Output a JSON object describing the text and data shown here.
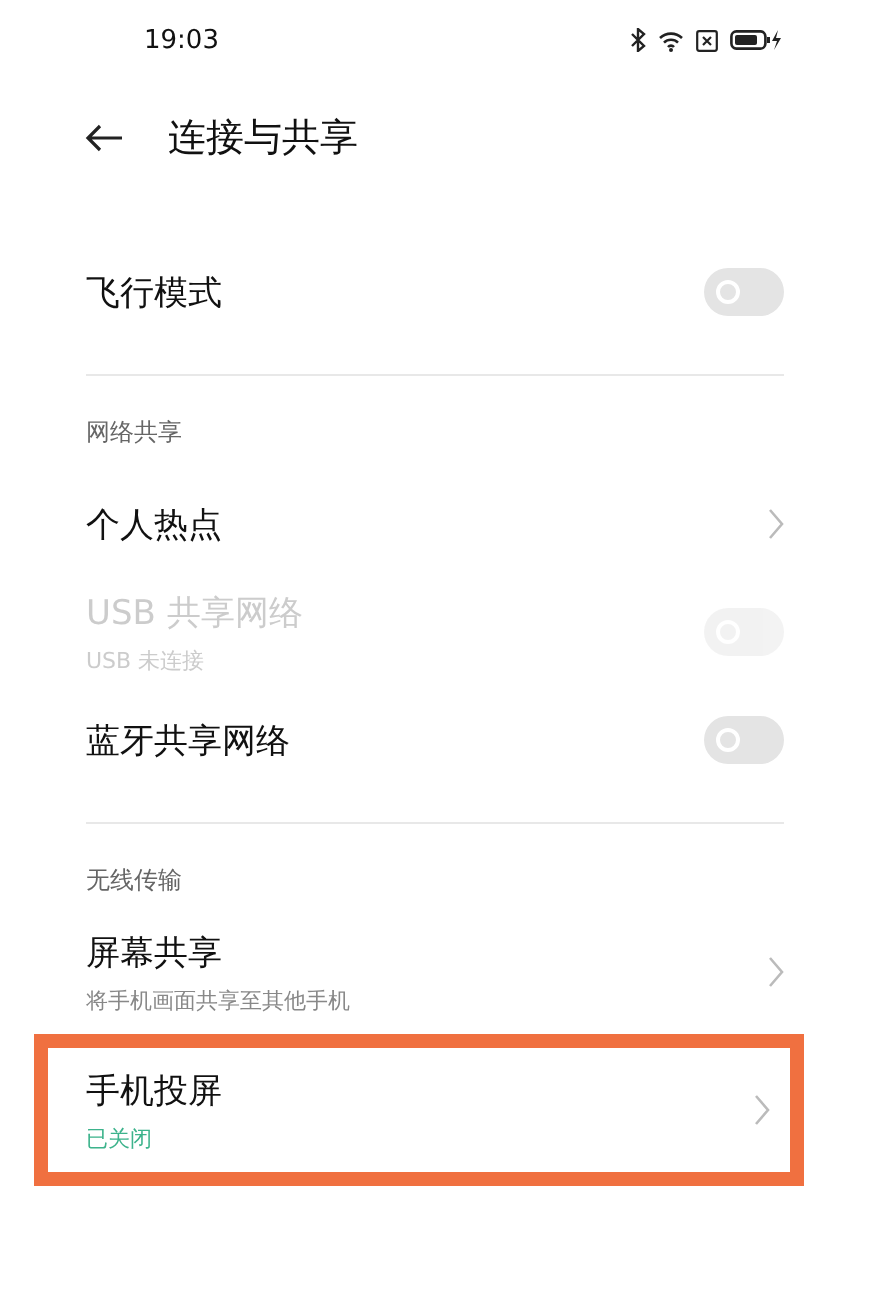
{
  "status_bar": {
    "time": "19:03"
  },
  "header": {
    "title": "连接与共享"
  },
  "sections": [
    {
      "items": [
        {
          "kind": "toggle",
          "title": "飞行模式",
          "on": false,
          "disabled": false,
          "highlighted": false
        }
      ]
    },
    {
      "heading": "网络共享",
      "items": [
        {
          "kind": "link",
          "title": "个人热点",
          "disabled": false,
          "highlighted": false
        },
        {
          "kind": "toggle",
          "title": "USB 共享网络",
          "subtitle": "USB 未连接",
          "subtitle_accent": false,
          "on": false,
          "disabled": true,
          "highlighted": false
        },
        {
          "kind": "toggle",
          "title": "蓝牙共享网络",
          "on": false,
          "disabled": false,
          "highlighted": false
        }
      ]
    },
    {
      "heading": "无线传输",
      "items": [
        {
          "kind": "link",
          "title": "屏幕共享",
          "subtitle": "将手机画面共享至其他手机",
          "subtitle_accent": false,
          "disabled": false,
          "highlighted": false
        },
        {
          "kind": "link",
          "title": "手机投屏",
          "subtitle": "已关闭",
          "subtitle_accent": true,
          "disabled": false,
          "highlighted": true
        }
      ]
    }
  ]
}
